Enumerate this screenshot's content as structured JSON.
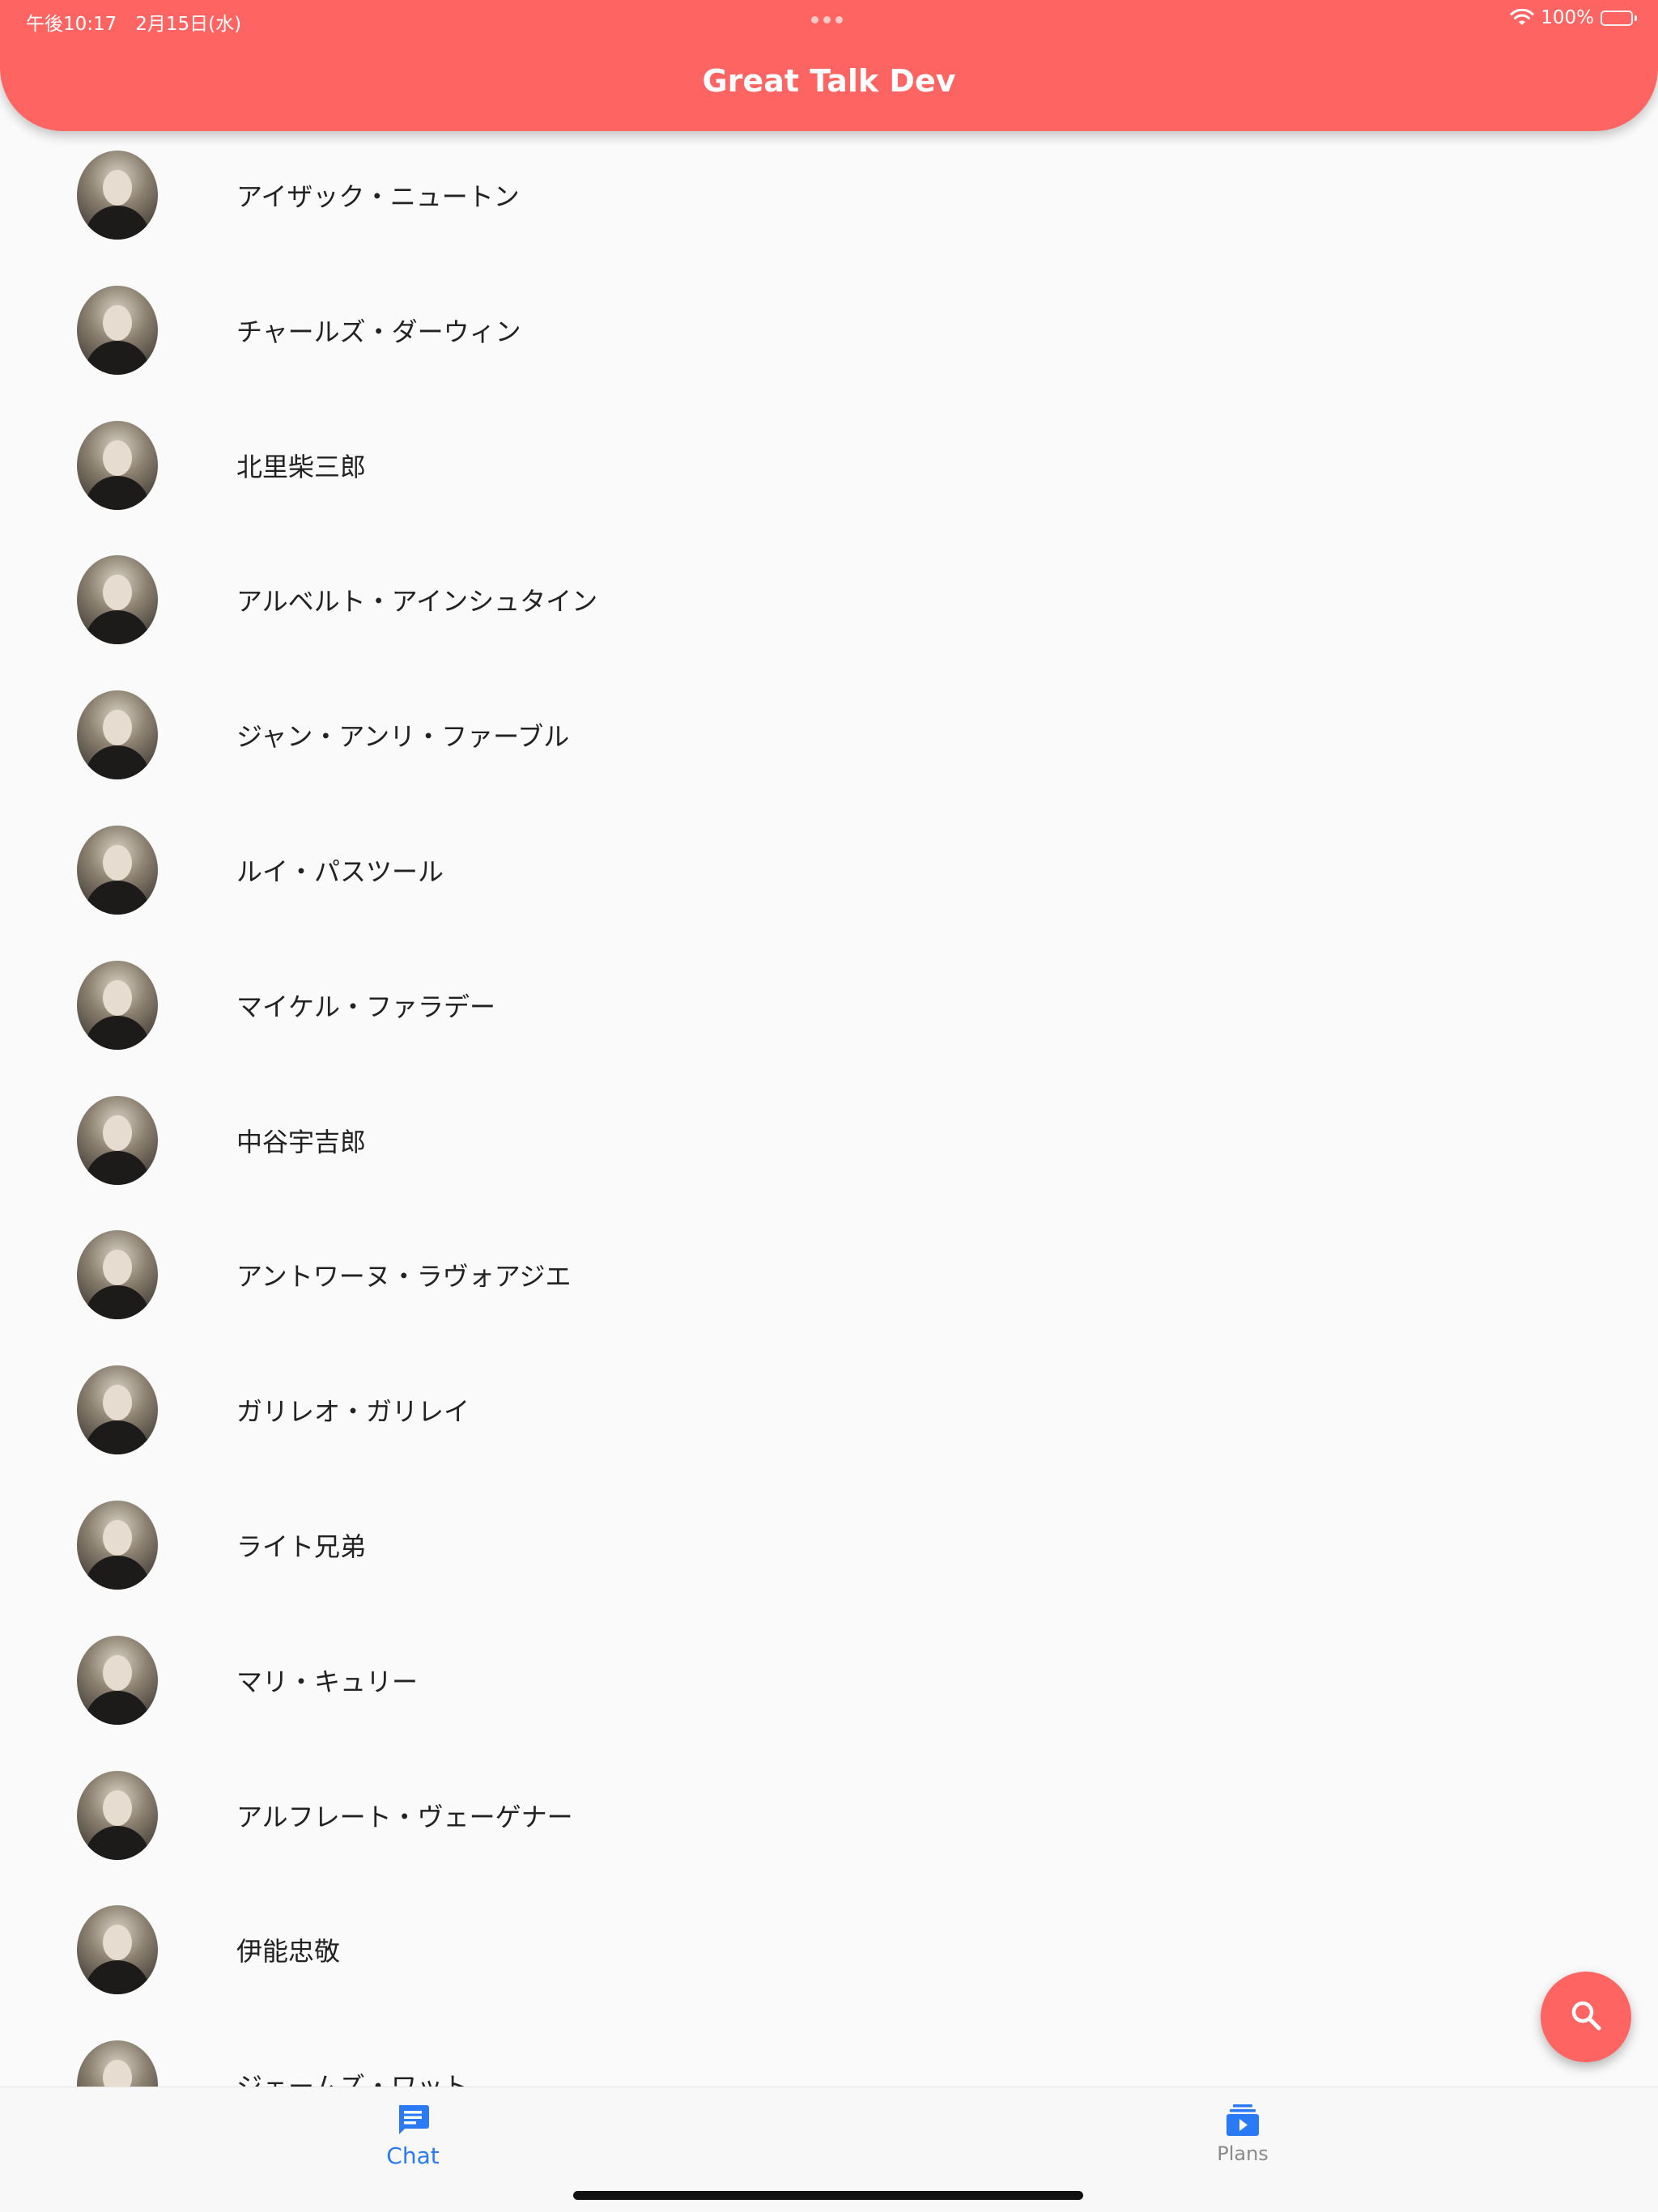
{
  "status_bar": {
    "time_date": "午後10:17　2月15日(水)",
    "battery": "100%",
    "battery_level": 1.0
  },
  "header": {
    "title": "Great Talk Dev"
  },
  "list": {
    "items": [
      {
        "name": "アイザック・ニュートン"
      },
      {
        "name": "チャールズ・ダーウィン"
      },
      {
        "name": "北里柴三郎"
      },
      {
        "name": "アルベルト・アインシュタイン"
      },
      {
        "name": "ジャン・アンリ・ファーブル"
      },
      {
        "name": "ルイ・パスツール"
      },
      {
        "name": "マイケル・ファラデー"
      },
      {
        "name": "中谷宇吉郎"
      },
      {
        "name": "アントワーヌ・ラヴォアジエ"
      },
      {
        "name": "ガリレオ・ガリレイ"
      },
      {
        "name": "ライト兄弟"
      },
      {
        "name": "マリ・キュリー"
      },
      {
        "name": "アルフレート・ヴェーゲナー"
      },
      {
        "name": "伊能忠敬"
      },
      {
        "name": "ジェームズ・ワット"
      }
    ]
  },
  "fab": {
    "icon": "search-icon",
    "color": "#fe6462"
  },
  "bottom_nav": {
    "chat_label": "Chat",
    "plans_label": "Plans",
    "active": "Chat",
    "active_color": "#2a79f5",
    "inactive_color": "#8a8a8a"
  },
  "colors": {
    "accent": "#fe6462",
    "background": "#fafafa"
  }
}
